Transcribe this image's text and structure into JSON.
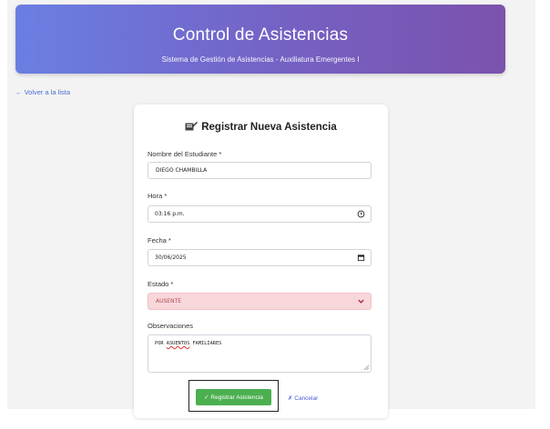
{
  "header": {
    "title": "Control de Asistencias",
    "subtitle": "Sistema de Gestión de Asistencias - Auxiliatura Emergentes I"
  },
  "nav": {
    "back_label": "← Volver a la lista"
  },
  "form": {
    "title": "Registrar Nueva Asistencia",
    "title_icon": "memo-icon",
    "student": {
      "label": "Nombre del Estudiante *",
      "value": "DIEGO CHAMBILLA"
    },
    "time": {
      "label": "Hora *",
      "value": "03:16 p.m.",
      "icon": "clock-icon"
    },
    "date": {
      "label": "Fecha *",
      "value": "30/06/2025",
      "icon": "calendar-icon"
    },
    "status": {
      "label": "Estado *",
      "value": "AUSENTE",
      "icon": "chevron-down-icon",
      "color": "#f8d7da"
    },
    "notes": {
      "label": "Observaciones",
      "value_pre": "POR ",
      "value_under": "ASUENTOS",
      "value_post": " FAMILIARES"
    },
    "submit_label": "✓ Registrar Asistencia",
    "cancel_label": "✗ Cancelar"
  },
  "colors": {
    "header_start": "#6a7fe3",
    "header_end": "#7b52ac",
    "submit": "#4caf50",
    "link": "#4a6fd6"
  }
}
